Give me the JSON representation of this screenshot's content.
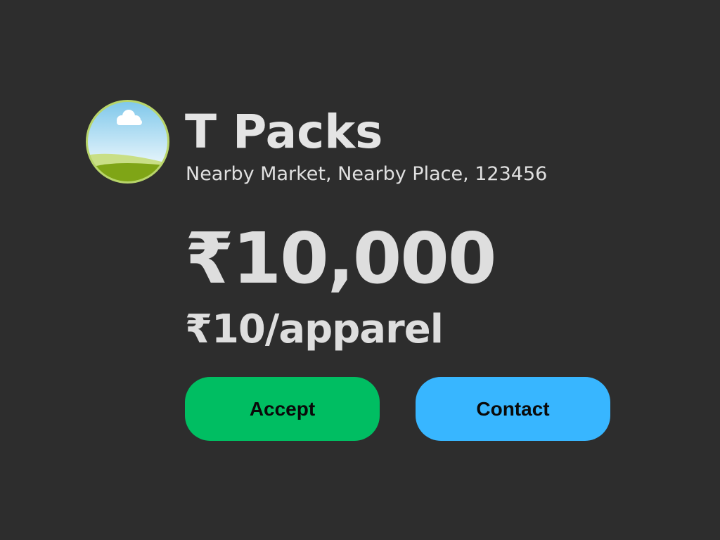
{
  "vendor": {
    "name": "T Packs",
    "address": "Nearby Market, Nearby Place, 123456",
    "avatar_icon": "landscape-placeholder-icon"
  },
  "quote": {
    "total": "₹10,000",
    "rate": "₹10/apparel"
  },
  "actions": {
    "accept_label": "Accept",
    "contact_label": "Contact"
  },
  "colors": {
    "background": "#2d2d2d",
    "text": "#e2e2e2",
    "accept": "#00be62",
    "contact": "#38b6ff"
  }
}
